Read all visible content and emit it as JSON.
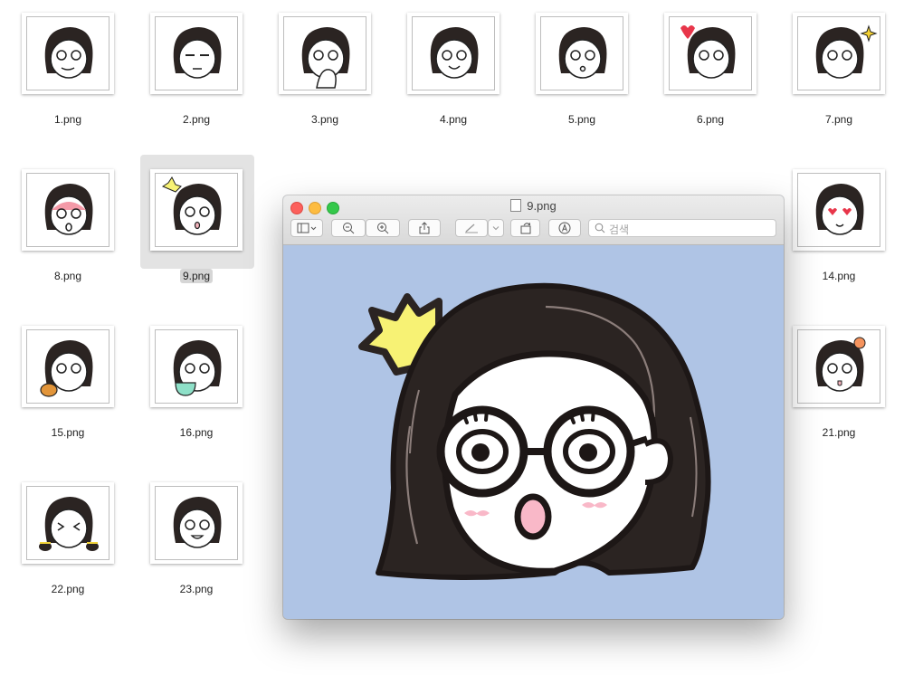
{
  "files": [
    {
      "name": "1.png"
    },
    {
      "name": "2.png"
    },
    {
      "name": "3.png"
    },
    {
      "name": "4.png"
    },
    {
      "name": "5.png"
    },
    {
      "name": "6.png"
    },
    {
      "name": "7.png"
    },
    {
      "name": "8.png"
    },
    {
      "name": "9.png",
      "selected": true
    },
    {
      "name": "14.png"
    },
    {
      "name": "15.png"
    },
    {
      "name": "16.png"
    },
    {
      "name": "21.png"
    },
    {
      "name": "22.png"
    },
    {
      "name": "23.png"
    }
  ],
  "preview_window": {
    "title": "9.png",
    "search_placeholder": "검색",
    "background_color": "#afc4e5"
  }
}
